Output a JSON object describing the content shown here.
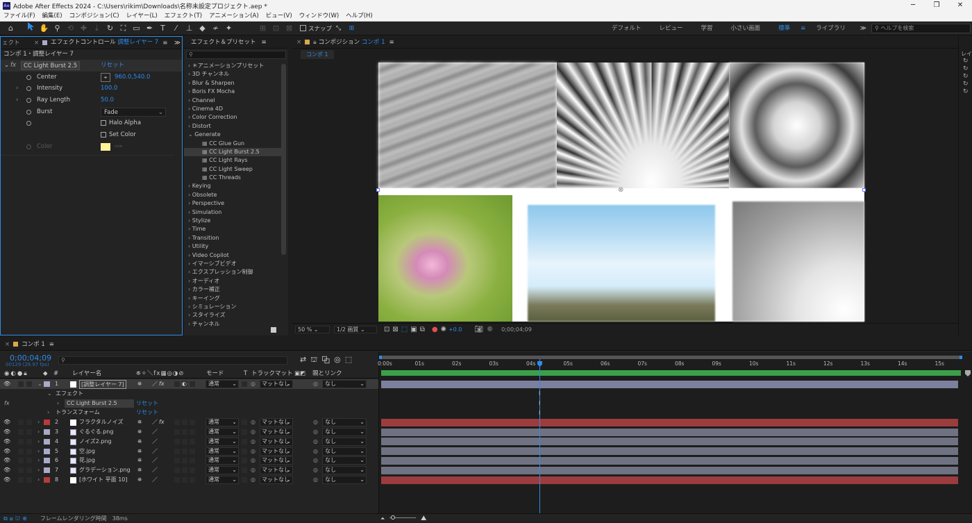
{
  "window": {
    "title": "Adobe After Effects 2024 - C:\\Users\\rikim\\Downloads\\名称未設定プロジェクト.aep *",
    "app_badge": "Ae",
    "min": "─",
    "max": "❐",
    "close": "✕"
  },
  "menu": [
    "ファイル(F)",
    "編集(E)",
    "コンポジション(C)",
    "レイヤー(L)",
    "エフェクト(T)",
    "アニメーション(A)",
    "ビュー(V)",
    "ウィンドウ(W)",
    "ヘルプ(H)"
  ],
  "toolbar": {
    "snap_label": "スナップ",
    "workspaces": [
      "デフォルト",
      "レビュー",
      "学習",
      "小さい画面",
      "標準",
      "ライブラリ"
    ],
    "active_workspace": "標準",
    "overflow": "≫",
    "help_search_placeholder": "ヘルプを検索"
  },
  "effect_controls": {
    "side_tab": "ェクト",
    "tab_prefix": "エフェクトコントロール",
    "tab_layer": "調整レイヤー 7",
    "breadcrumb": "コンポ 1・調整レイヤー 7",
    "effect_name": "CC Light Burst 2.5",
    "reset": "リセット",
    "props": [
      {
        "name": "Center",
        "value": "960.0,540.0",
        "kind": "point"
      },
      {
        "name": "Intensity",
        "value": "100.0",
        "kind": "num"
      },
      {
        "name": "Ray Length",
        "value": "50.0",
        "kind": "num"
      },
      {
        "name": "Burst",
        "value": "Fade",
        "kind": "select"
      },
      {
        "name": "",
        "value": "Halo Alpha",
        "kind": "check"
      },
      {
        "name": "",
        "value": "Set Color",
        "kind": "check"
      },
      {
        "name": "Color",
        "value": "",
        "kind": "color"
      }
    ],
    "swatch_color": "#fff29a"
  },
  "effects_presets": {
    "tab": "エフェクト＆プリセット",
    "search_placeholder": "",
    "items": [
      {
        "label": "＊アニメーションプリセット",
        "sub": false,
        "open": false
      },
      {
        "label": "3D チャンネル",
        "sub": false
      },
      {
        "label": "Blur & Sharpen",
        "sub": false
      },
      {
        "label": "Boris FX Mocha",
        "sub": false
      },
      {
        "label": "Channel",
        "sub": false
      },
      {
        "label": "Cinema 4D",
        "sub": false
      },
      {
        "label": "Color Correction",
        "sub": false
      },
      {
        "label": "Distort",
        "sub": false
      },
      {
        "label": "Generate",
        "sub": false,
        "open": true
      },
      {
        "label": "CC Glue Gun",
        "sub": true
      },
      {
        "label": "CC Light Burst 2.5",
        "sub": true,
        "selected": true
      },
      {
        "label": "CC Light Rays",
        "sub": true
      },
      {
        "label": "CC Light Sweep",
        "sub": true
      },
      {
        "label": "CC Threads",
        "sub": true
      },
      {
        "label": "Keying",
        "sub": false
      },
      {
        "label": "Obsolete",
        "sub": false
      },
      {
        "label": "Perspective",
        "sub": false
      },
      {
        "label": "Simulation",
        "sub": false
      },
      {
        "label": "Stylize",
        "sub": false
      },
      {
        "label": "Time",
        "sub": false
      },
      {
        "label": "Transition",
        "sub": false
      },
      {
        "label": "Utility",
        "sub": false
      },
      {
        "label": "Video Copilot",
        "sub": false
      },
      {
        "label": "イマーシブビデオ",
        "sub": false
      },
      {
        "label": "エクスプレッション制御",
        "sub": false
      },
      {
        "label": "オーディオ",
        "sub": false
      },
      {
        "label": "カラー補正",
        "sub": false
      },
      {
        "label": "キーイング",
        "sub": false
      },
      {
        "label": "シミュレーション",
        "sub": false
      },
      {
        "label": "スタイライズ",
        "sub": false
      },
      {
        "label": "チャンネル",
        "sub": false
      }
    ]
  },
  "composition": {
    "tab_prefix": "コンポジション",
    "tab_name": "コンポ 1",
    "subtab": "コンポ 1",
    "zoom": "50 %",
    "resolution": "1/2 画質",
    "exposure": "+0.0",
    "timecode": "0;00;04;09",
    "side_label": "レイ"
  },
  "timeline": {
    "tab": "コンポ 1",
    "current_time": "0;00;04;09",
    "frame_info": "00129 (29.97 fps)",
    "headers": {
      "layer_name": "レイヤー名",
      "mode": "モード",
      "trackmatte_t": "T",
      "trackmatte": "トラックマット",
      "parent": "親とリンク"
    },
    "ruler": [
      "0:00s",
      "01s",
      "02s",
      "03s",
      "04s",
      "05s",
      "06s",
      "07s",
      "08s",
      "09s",
      "10s",
      "11s",
      "12s",
      "13s",
      "14s",
      "15s"
    ],
    "effect_group": "エフェクト",
    "effect_item": "CC Light Burst 2.5",
    "transform": "トランスフォーム",
    "reset": "リセット",
    "layers": [
      {
        "num": "1",
        "name": "[調整レイヤー 7]",
        "label_color": "#a9a9c8",
        "mode": "通常",
        "matte": "マットなし",
        "parent": "なし",
        "bar": "#7d7f9e",
        "fx": true,
        "kind": "solid"
      },
      {
        "num": "2",
        "name": "フラクタルノイズ",
        "label_color": "#b83a3a",
        "mode": "通常",
        "matte": "マットなし",
        "parent": "なし",
        "bar": "#9c3c3e",
        "fx": true,
        "kind": "solid"
      },
      {
        "num": "3",
        "name": "ぐるぐる.png",
        "label_color": "#a9a9c8",
        "mode": "通常",
        "matte": "マットなし",
        "parent": "なし",
        "bar": "#6f7282",
        "fx": false,
        "kind": "file"
      },
      {
        "num": "4",
        "name": "ノイズ2.png",
        "label_color": "#a9a9c8",
        "mode": "通常",
        "matte": "マットなし",
        "parent": "なし",
        "bar": "#6f7282",
        "fx": false,
        "kind": "file"
      },
      {
        "num": "5",
        "name": "空.jpg",
        "label_color": "#a9a9c8",
        "mode": "通常",
        "matte": "マットなし",
        "parent": "なし",
        "bar": "#6f7282",
        "fx": false,
        "kind": "file"
      },
      {
        "num": "6",
        "name": "花.jpg",
        "label_color": "#a9a9c8",
        "mode": "通常",
        "matte": "マットなし",
        "parent": "なし",
        "bar": "#6f7282",
        "fx": false,
        "kind": "file"
      },
      {
        "num": "7",
        "name": "グラデーション.png",
        "label_color": "#a9a9c8",
        "mode": "通常",
        "matte": "マットなし",
        "parent": "なし",
        "bar": "#6f7282",
        "fx": false,
        "kind": "file"
      },
      {
        "num": "8",
        "name": "[ホワイト 平面 10]",
        "label_color": "#b83a3a",
        "mode": "通常",
        "matte": "マットなし",
        "parent": "なし",
        "bar": "#9c3c3e",
        "fx": false,
        "kind": "solid"
      }
    ]
  },
  "status": {
    "label": "フレームレンダリング時間",
    "value": "38ms"
  },
  "colors": {
    "accent": "#2d8ceb"
  }
}
